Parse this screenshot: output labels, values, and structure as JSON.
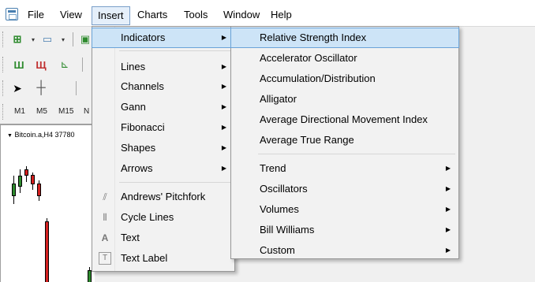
{
  "menubar": {
    "items": [
      "File",
      "View",
      "Insert",
      "Charts",
      "Tools",
      "Window",
      "Help"
    ]
  },
  "toolbar": {
    "timeframes": [
      "M1",
      "M5",
      "M15",
      "N"
    ]
  },
  "chart": {
    "title": "Bitcoin.a,H4  37780"
  },
  "insert_menu": {
    "items": [
      {
        "label": "Indicators",
        "submenu": true,
        "highlighted": true
      },
      {
        "label": "Lines",
        "submenu": true
      },
      {
        "label": "Channels",
        "submenu": true
      },
      {
        "label": "Gann",
        "submenu": true
      },
      {
        "label": "Fibonacci",
        "submenu": true
      },
      {
        "label": "Shapes",
        "submenu": true
      },
      {
        "label": "Arrows",
        "submenu": true
      },
      {
        "label": "Andrews' Pitchfork",
        "icon": "pitchfork-icon"
      },
      {
        "label": "Cycle Lines",
        "icon": "cycle-lines-icon"
      },
      {
        "label": "Text",
        "icon": "text-icon"
      },
      {
        "label": "Text Label",
        "icon": "text-label-icon"
      }
    ]
  },
  "indicators_menu": {
    "items": [
      {
        "label": "Relative Strength Index",
        "highlighted": true
      },
      {
        "label": "Accelerator Oscillator"
      },
      {
        "label": "Accumulation/Distribution"
      },
      {
        "label": "Alligator"
      },
      {
        "label": "Average Directional Movement Index"
      },
      {
        "label": "Average True Range"
      },
      {
        "label": "Trend",
        "submenu": true
      },
      {
        "label": "Oscillators",
        "submenu": true
      },
      {
        "label": "Volumes",
        "submenu": true
      },
      {
        "label": "Bill Williams",
        "submenu": true
      },
      {
        "label": "Custom",
        "submenu": true
      }
    ]
  },
  "colors": {
    "highlight": "#cde4f7",
    "highlight_border": "#6aa3d8",
    "bull_candle": "#2e8b2e",
    "bear_candle": "#d42020"
  }
}
